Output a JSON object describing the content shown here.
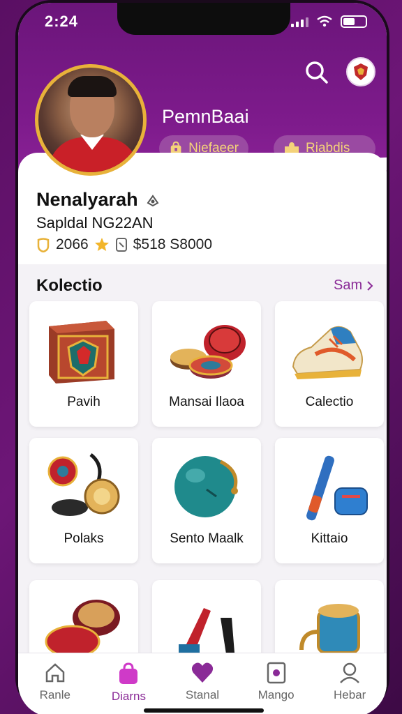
{
  "status_bar": {
    "time": "2:24"
  },
  "header": {
    "team_name": "PemnBaai",
    "chips": [
      {
        "label": "Niefaeer",
        "icon": "bag-icon"
      },
      {
        "label": "Riabdis",
        "icon": "puzzle-icon"
      }
    ]
  },
  "profile": {
    "name": "Nenalyarah",
    "subtitle": "Sapldal NG22AN",
    "stat_count": "2066",
    "stat_value": "$518 S8000"
  },
  "collection": {
    "title": "Kolectio",
    "see_all": "Sam",
    "items": [
      {
        "label": "Pavih"
      },
      {
        "label": "Mansai Ilaoa"
      },
      {
        "label": "Calectio"
      },
      {
        "label": "Polaks"
      },
      {
        "label": "Sento Maalk"
      },
      {
        "label": "Kittaio"
      }
    ]
  },
  "tabs": [
    {
      "label": "Ranle",
      "icon": "home-icon"
    },
    {
      "label": "Diarns",
      "icon": "bag-icon"
    },
    {
      "label": "Stanal",
      "icon": "heart-icon"
    },
    {
      "label": "Mango",
      "icon": "card-icon"
    },
    {
      "label": "Hebar",
      "icon": "profile-icon"
    }
  ],
  "colors": {
    "brand": "#7e1b8c",
    "accent": "#e8b23a",
    "active_tab": "#8a2a97"
  }
}
